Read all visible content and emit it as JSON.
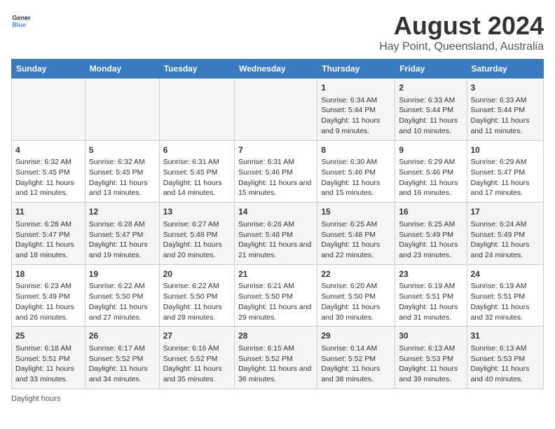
{
  "header": {
    "logo_general": "General",
    "logo_blue": "Blue",
    "main_title": "August 2024",
    "subtitle": "Hay Point, Queensland, Australia"
  },
  "days_of_week": [
    "Sunday",
    "Monday",
    "Tuesday",
    "Wednesday",
    "Thursday",
    "Friday",
    "Saturday"
  ],
  "weeks": [
    [
      {
        "day": "",
        "info": ""
      },
      {
        "day": "",
        "info": ""
      },
      {
        "day": "",
        "info": ""
      },
      {
        "day": "",
        "info": ""
      },
      {
        "day": "1",
        "info": "Sunrise: 6:34 AM\nSunset: 5:44 PM\nDaylight: 11 hours and 9 minutes."
      },
      {
        "day": "2",
        "info": "Sunrise: 6:33 AM\nSunset: 5:44 PM\nDaylight: 11 hours and 10 minutes."
      },
      {
        "day": "3",
        "info": "Sunrise: 6:33 AM\nSunset: 5:44 PM\nDaylight: 11 hours and 11 minutes."
      }
    ],
    [
      {
        "day": "4",
        "info": "Sunrise: 6:32 AM\nSunset: 5:45 PM\nDaylight: 11 hours and 12 minutes."
      },
      {
        "day": "5",
        "info": "Sunrise: 6:32 AM\nSunset: 5:45 PM\nDaylight: 11 hours and 13 minutes."
      },
      {
        "day": "6",
        "info": "Sunrise: 6:31 AM\nSunset: 5:45 PM\nDaylight: 11 hours and 14 minutes."
      },
      {
        "day": "7",
        "info": "Sunrise: 6:31 AM\nSunset: 5:46 PM\nDaylight: 11 hours and 15 minutes."
      },
      {
        "day": "8",
        "info": "Sunrise: 6:30 AM\nSunset: 5:46 PM\nDaylight: 11 hours and 15 minutes."
      },
      {
        "day": "9",
        "info": "Sunrise: 6:29 AM\nSunset: 5:46 PM\nDaylight: 11 hours and 16 minutes."
      },
      {
        "day": "10",
        "info": "Sunrise: 6:29 AM\nSunset: 5:47 PM\nDaylight: 11 hours and 17 minutes."
      }
    ],
    [
      {
        "day": "11",
        "info": "Sunrise: 6:28 AM\nSunset: 5:47 PM\nDaylight: 11 hours and 18 minutes."
      },
      {
        "day": "12",
        "info": "Sunrise: 6:28 AM\nSunset: 5:47 PM\nDaylight: 11 hours and 19 minutes."
      },
      {
        "day": "13",
        "info": "Sunrise: 6:27 AM\nSunset: 5:48 PM\nDaylight: 11 hours and 20 minutes."
      },
      {
        "day": "14",
        "info": "Sunrise: 6:26 AM\nSunset: 5:48 PM\nDaylight: 11 hours and 21 minutes."
      },
      {
        "day": "15",
        "info": "Sunrise: 6:25 AM\nSunset: 5:48 PM\nDaylight: 11 hours and 22 minutes."
      },
      {
        "day": "16",
        "info": "Sunrise: 6:25 AM\nSunset: 5:49 PM\nDaylight: 11 hours and 23 minutes."
      },
      {
        "day": "17",
        "info": "Sunrise: 6:24 AM\nSunset: 5:49 PM\nDaylight: 11 hours and 24 minutes."
      }
    ],
    [
      {
        "day": "18",
        "info": "Sunrise: 6:23 AM\nSunset: 5:49 PM\nDaylight: 11 hours and 26 minutes."
      },
      {
        "day": "19",
        "info": "Sunrise: 6:22 AM\nSunset: 5:50 PM\nDaylight: 11 hours and 27 minutes."
      },
      {
        "day": "20",
        "info": "Sunrise: 6:22 AM\nSunset: 5:50 PM\nDaylight: 11 hours and 28 minutes."
      },
      {
        "day": "21",
        "info": "Sunrise: 6:21 AM\nSunset: 5:50 PM\nDaylight: 11 hours and 29 minutes."
      },
      {
        "day": "22",
        "info": "Sunrise: 6:20 AM\nSunset: 5:50 PM\nDaylight: 11 hours and 30 minutes."
      },
      {
        "day": "23",
        "info": "Sunrise: 6:19 AM\nSunset: 5:51 PM\nDaylight: 11 hours and 31 minutes."
      },
      {
        "day": "24",
        "info": "Sunrise: 6:19 AM\nSunset: 5:51 PM\nDaylight: 11 hours and 32 minutes."
      }
    ],
    [
      {
        "day": "25",
        "info": "Sunrise: 6:18 AM\nSunset: 5:51 PM\nDaylight: 11 hours and 33 minutes."
      },
      {
        "day": "26",
        "info": "Sunrise: 6:17 AM\nSunset: 5:52 PM\nDaylight: 11 hours and 34 minutes."
      },
      {
        "day": "27",
        "info": "Sunrise: 6:16 AM\nSunset: 5:52 PM\nDaylight: 11 hours and 35 minutes."
      },
      {
        "day": "28",
        "info": "Sunrise: 6:15 AM\nSunset: 5:52 PM\nDaylight: 11 hours and 36 minutes."
      },
      {
        "day": "29",
        "info": "Sunrise: 6:14 AM\nSunset: 5:52 PM\nDaylight: 11 hours and 38 minutes."
      },
      {
        "day": "30",
        "info": "Sunrise: 6:13 AM\nSunset: 5:53 PM\nDaylight: 11 hours and 39 minutes."
      },
      {
        "day": "31",
        "info": "Sunrise: 6:13 AM\nSunset: 5:53 PM\nDaylight: 11 hours and 40 minutes."
      }
    ]
  ],
  "legend": "Daylight hours"
}
